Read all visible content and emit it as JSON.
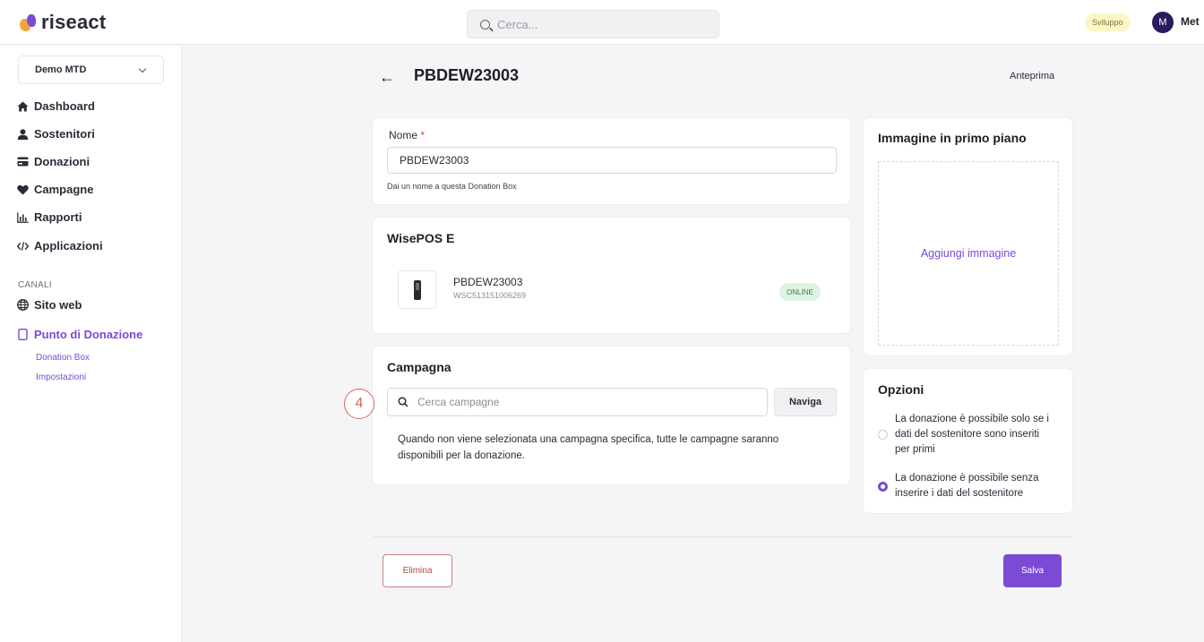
{
  "header": {
    "logo_text": "riseact",
    "search_placeholder": "Cerca...",
    "env_badge": "Sviluppo",
    "avatar_initial": "M",
    "user_name": "Met"
  },
  "sidebar": {
    "org_name": "Demo MTD",
    "items": [
      {
        "label": "Dashboard",
        "icon": "home-icon"
      },
      {
        "label": "Sostenitori",
        "icon": "user-icon"
      },
      {
        "label": "Donazioni",
        "icon": "card-icon"
      },
      {
        "label": "Campagne",
        "icon": "heart-icon"
      },
      {
        "label": "Rapporti",
        "icon": "chart-icon"
      },
      {
        "label": "Applicazioni",
        "icon": "code-icon"
      }
    ],
    "section_label": "CANALI",
    "channels": [
      {
        "label": "Sito web",
        "icon": "globe-icon"
      },
      {
        "label": "Punto di Donazione",
        "icon": "device-icon",
        "active": true
      }
    ],
    "sub_items": [
      "Donation Box",
      "Impostazioni"
    ]
  },
  "page": {
    "title": "PBDEW23003",
    "preview_label": "Anteprima"
  },
  "name_card": {
    "label": "Nome",
    "required_mark": "*",
    "value": "PBDEW23003",
    "help": "Dai un nome a questa Donation Box"
  },
  "device_card": {
    "title": "WisePOS E",
    "device_name": "PBDEW23003",
    "serial": "WSC513151006269",
    "status": "ONLINE"
  },
  "campaign_card": {
    "title": "Campagna",
    "search_placeholder": "Cerca campagne",
    "browse_label": "Naviga",
    "help": "Quando non viene selezionata una campagna specifica, tutte le campagne saranno disponibili per la donazione."
  },
  "step_marker": "4",
  "image_card": {
    "title": "Immagine in primo piano",
    "add_label": "Aggiungi immagine"
  },
  "options_card": {
    "title": "Opzioni",
    "options": [
      {
        "label": "La donazione è possibile solo se i dati del sostenitore sono inseriti per primi",
        "checked": false
      },
      {
        "label": "La donazione è possibile senza inserire i dati del sostenitore",
        "checked": true
      }
    ]
  },
  "actions": {
    "delete_label": "Elimina",
    "save_label": "Salva"
  },
  "colors": {
    "accent": "#7b4bd6",
    "danger": "#b24a3a",
    "online": "#def4e3"
  }
}
